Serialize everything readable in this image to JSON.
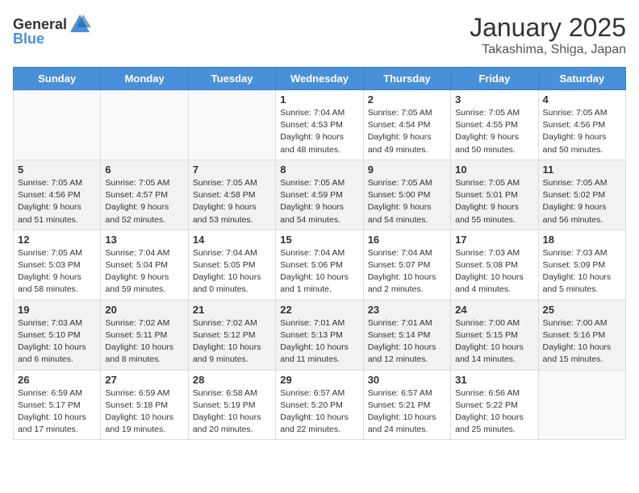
{
  "header": {
    "logo_general": "General",
    "logo_blue": "Blue",
    "month": "January 2025",
    "location": "Takashima, Shiga, Japan"
  },
  "weekdays": [
    "Sunday",
    "Monday",
    "Tuesday",
    "Wednesday",
    "Thursday",
    "Friday",
    "Saturday"
  ],
  "weeks": [
    [
      {
        "day": "",
        "info": ""
      },
      {
        "day": "",
        "info": ""
      },
      {
        "day": "",
        "info": ""
      },
      {
        "day": "1",
        "info": "Sunrise: 7:04 AM\nSunset: 4:53 PM\nDaylight: 9 hours\nand 48 minutes."
      },
      {
        "day": "2",
        "info": "Sunrise: 7:05 AM\nSunset: 4:54 PM\nDaylight: 9 hours\nand 49 minutes."
      },
      {
        "day": "3",
        "info": "Sunrise: 7:05 AM\nSunset: 4:55 PM\nDaylight: 9 hours\nand 50 minutes."
      },
      {
        "day": "4",
        "info": "Sunrise: 7:05 AM\nSunset: 4:56 PM\nDaylight: 9 hours\nand 50 minutes."
      }
    ],
    [
      {
        "day": "5",
        "info": "Sunrise: 7:05 AM\nSunset: 4:56 PM\nDaylight: 9 hours\nand 51 minutes."
      },
      {
        "day": "6",
        "info": "Sunrise: 7:05 AM\nSunset: 4:57 PM\nDaylight: 9 hours\nand 52 minutes."
      },
      {
        "day": "7",
        "info": "Sunrise: 7:05 AM\nSunset: 4:58 PM\nDaylight: 9 hours\nand 53 minutes."
      },
      {
        "day": "8",
        "info": "Sunrise: 7:05 AM\nSunset: 4:59 PM\nDaylight: 9 hours\nand 54 minutes."
      },
      {
        "day": "9",
        "info": "Sunrise: 7:05 AM\nSunset: 5:00 PM\nDaylight: 9 hours\nand 54 minutes."
      },
      {
        "day": "10",
        "info": "Sunrise: 7:05 AM\nSunset: 5:01 PM\nDaylight: 9 hours\nand 55 minutes."
      },
      {
        "day": "11",
        "info": "Sunrise: 7:05 AM\nSunset: 5:02 PM\nDaylight: 9 hours\nand 56 minutes."
      }
    ],
    [
      {
        "day": "12",
        "info": "Sunrise: 7:05 AM\nSunset: 5:03 PM\nDaylight: 9 hours\nand 58 minutes."
      },
      {
        "day": "13",
        "info": "Sunrise: 7:04 AM\nSunset: 5:04 PM\nDaylight: 9 hours\nand 59 minutes."
      },
      {
        "day": "14",
        "info": "Sunrise: 7:04 AM\nSunset: 5:05 PM\nDaylight: 10 hours\nand 0 minutes."
      },
      {
        "day": "15",
        "info": "Sunrise: 7:04 AM\nSunset: 5:06 PM\nDaylight: 10 hours\nand 1 minute."
      },
      {
        "day": "16",
        "info": "Sunrise: 7:04 AM\nSunset: 5:07 PM\nDaylight: 10 hours\nand 2 minutes."
      },
      {
        "day": "17",
        "info": "Sunrise: 7:03 AM\nSunset: 5:08 PM\nDaylight: 10 hours\nand 4 minutes."
      },
      {
        "day": "18",
        "info": "Sunrise: 7:03 AM\nSunset: 5:09 PM\nDaylight: 10 hours\nand 5 minutes."
      }
    ],
    [
      {
        "day": "19",
        "info": "Sunrise: 7:03 AM\nSunset: 5:10 PM\nDaylight: 10 hours\nand 6 minutes."
      },
      {
        "day": "20",
        "info": "Sunrise: 7:02 AM\nSunset: 5:11 PM\nDaylight: 10 hours\nand 8 minutes."
      },
      {
        "day": "21",
        "info": "Sunrise: 7:02 AM\nSunset: 5:12 PM\nDaylight: 10 hours\nand 9 minutes."
      },
      {
        "day": "22",
        "info": "Sunrise: 7:01 AM\nSunset: 5:13 PM\nDaylight: 10 hours\nand 11 minutes."
      },
      {
        "day": "23",
        "info": "Sunrise: 7:01 AM\nSunset: 5:14 PM\nDaylight: 10 hours\nand 12 minutes."
      },
      {
        "day": "24",
        "info": "Sunrise: 7:00 AM\nSunset: 5:15 PM\nDaylight: 10 hours\nand 14 minutes."
      },
      {
        "day": "25",
        "info": "Sunrise: 7:00 AM\nSunset: 5:16 PM\nDaylight: 10 hours\nand 15 minutes."
      }
    ],
    [
      {
        "day": "26",
        "info": "Sunrise: 6:59 AM\nSunset: 5:17 PM\nDaylight: 10 hours\nand 17 minutes."
      },
      {
        "day": "27",
        "info": "Sunrise: 6:59 AM\nSunset: 5:18 PM\nDaylight: 10 hours\nand 19 minutes."
      },
      {
        "day": "28",
        "info": "Sunrise: 6:58 AM\nSunset: 5:19 PM\nDaylight: 10 hours\nand 20 minutes."
      },
      {
        "day": "29",
        "info": "Sunrise: 6:57 AM\nSunset: 5:20 PM\nDaylight: 10 hours\nand 22 minutes."
      },
      {
        "day": "30",
        "info": "Sunrise: 6:57 AM\nSunset: 5:21 PM\nDaylight: 10 hours\nand 24 minutes."
      },
      {
        "day": "31",
        "info": "Sunrise: 6:56 AM\nSunset: 5:22 PM\nDaylight: 10 hours\nand 25 minutes."
      },
      {
        "day": "",
        "info": ""
      }
    ]
  ]
}
